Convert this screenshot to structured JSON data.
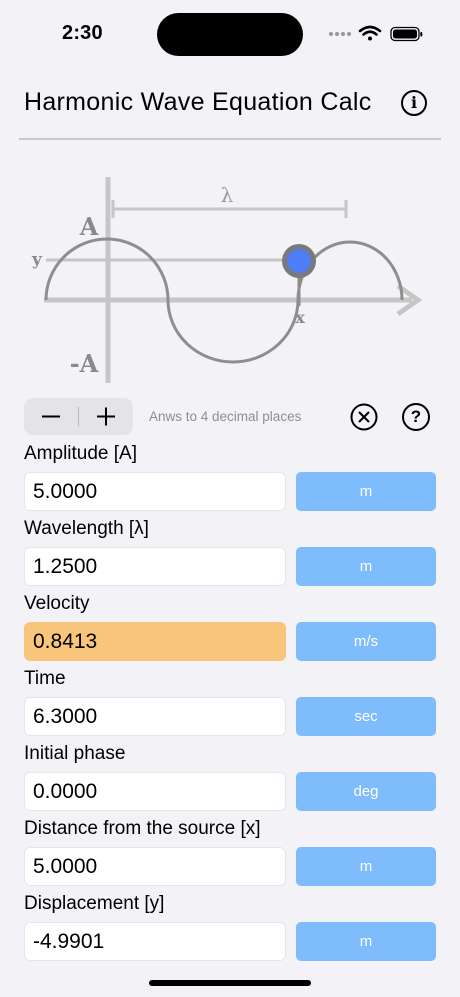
{
  "status": {
    "time": "2:30"
  },
  "header": {
    "title": "Harmonic Wave Equation Calc",
    "info_icon": "info-circle-icon"
  },
  "diagram": {
    "label_lambda": "λ",
    "label_A": "A",
    "label_negA": "-A",
    "label_y": "y",
    "label_x": "x",
    "colors": {
      "axis": "#c6c6c6",
      "wave": "#8e8e8e",
      "point": "#4d7df7",
      "point_ring": "#7a7a7a"
    }
  },
  "controls": {
    "minus": "−",
    "plus": "+",
    "hint": "Anws to 4 decimal places",
    "help": "?"
  },
  "fields": [
    {
      "label": "Amplitude [A]",
      "value": "5.0000",
      "unit": "m"
    },
    {
      "label": "Wavelength [λ]",
      "value": "1.2500",
      "unit": "m"
    },
    {
      "label": "Velocity",
      "value": "0.8413",
      "unit": "m/s"
    },
    {
      "label": "Time",
      "value": "6.3000",
      "unit": "sec"
    },
    {
      "label": "Initial phase",
      "value": "0.0000",
      "unit": "deg"
    },
    {
      "label": "Distance from the source [x]",
      "value": "5.0000",
      "unit": "m"
    },
    {
      "label": "Displacement [y]",
      "value": "-4.9901",
      "unit": "m"
    }
  ],
  "theme": {
    "accent": "#7fbcfb",
    "highlight": "#f8c57a",
    "background": "#f2f2f7"
  }
}
